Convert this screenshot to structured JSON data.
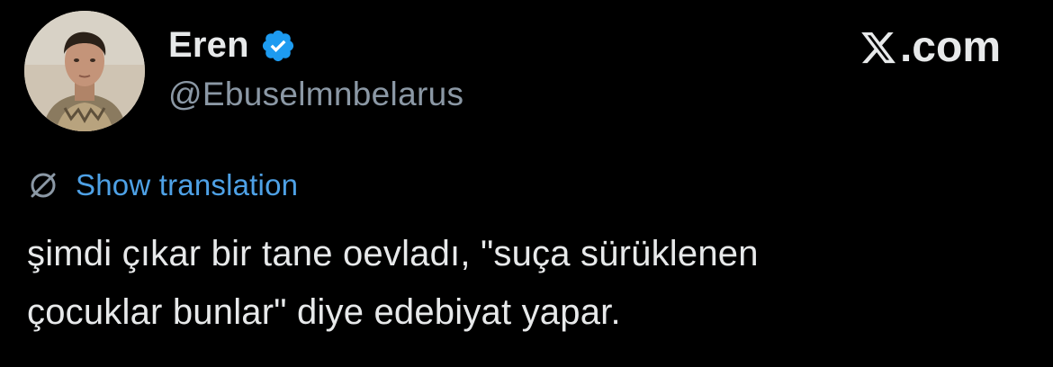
{
  "author": {
    "display_name": "Eren",
    "handle": "@Ebuselmnbelarus",
    "verified": true,
    "avatar_icon": "profile-photo"
  },
  "brand": {
    "logo_icon": "x-logo-icon",
    "text": ".com"
  },
  "translation": {
    "icon": "globe-slash-icon",
    "label": "Show translation"
  },
  "tweet": {
    "lines": [
      "şimdi çıkar bir tane oevladı, \"suça sürüklenen",
      "çocuklar bunlar\" diye edebiyat yapar."
    ]
  },
  "colors": {
    "background": "#000000",
    "text": "#e7e9ea",
    "muted": "#8b98a5",
    "link": "#4ea1e6",
    "verified_badge": "#1d9bf0"
  }
}
